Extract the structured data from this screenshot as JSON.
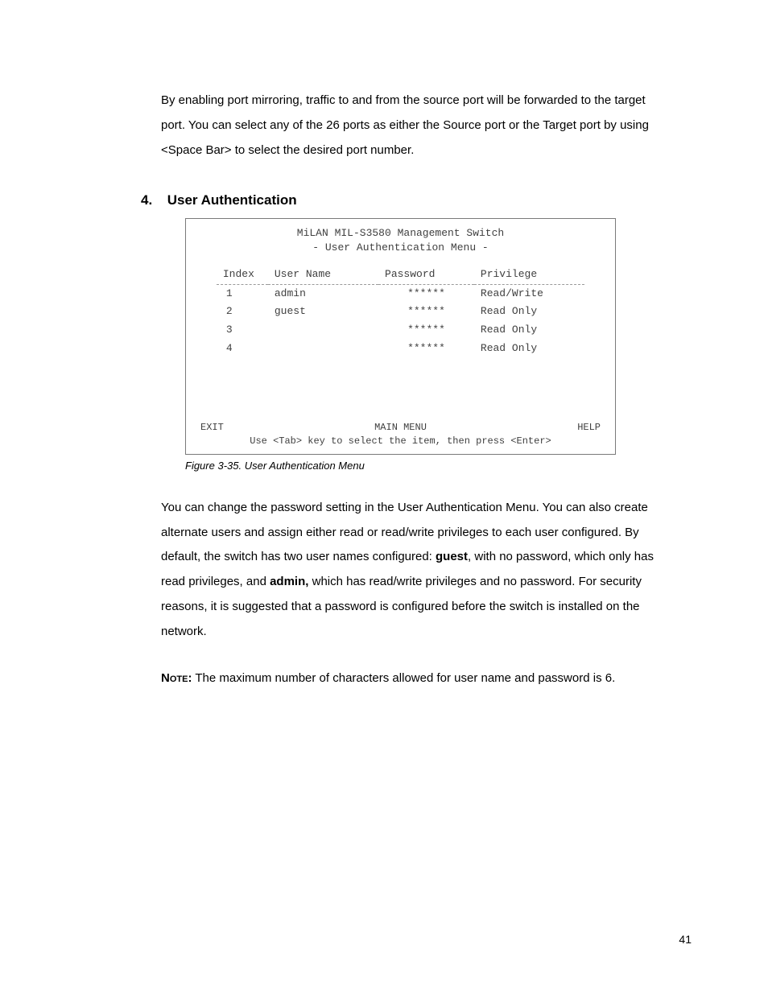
{
  "intro": "By enabling port mirroring, traffic to and from the source port will be forwarded to the target port. You can select any of the 26 ports as either the Source port or the Target port by using <Space Bar> to select the desired port number.",
  "section": {
    "number": "4.",
    "title": "User Authentication"
  },
  "figure": {
    "title": "MiLAN MIL-S3580 Management Switch",
    "subtitle": "- User Authentication Menu -",
    "headers": {
      "index": "Index",
      "user": "User Name",
      "password": "Password",
      "privilege": "Privilege"
    },
    "rows": [
      {
        "index": "1",
        "user": "admin",
        "password": "******",
        "privilege": "Read/Write"
      },
      {
        "index": "2",
        "user": "guest",
        "password": "******",
        "privilege": "Read Only"
      },
      {
        "index": "3",
        "user": "",
        "password": "******",
        "privilege": "Read Only"
      },
      {
        "index": "4",
        "user": "",
        "password": "******",
        "privilege": "Read Only"
      }
    ],
    "footer": {
      "left": "EXIT",
      "center_top": "MAIN MENU",
      "center_bottom": "Use <Tab> key to select the item, then press <Enter>",
      "right": "HELP"
    },
    "caption": "Figure 3-35. User Authentication Menu"
  },
  "body": {
    "p1_a": "You can change the password setting in the User Authentication Menu. You can also create alternate users and assign either read or read/write privileges to each user configured.   By default, the switch has two user names configured:  ",
    "guest": "guest",
    "p1_b": ", with no password, which only has read privileges, and ",
    "admin": "admin,",
    "p1_c": " which has read/write privileges and no password.  For security reasons, it is suggested that a password is configured before the switch is installed on the network.",
    "note_label": "Note:",
    "note_text": "  The maximum number of characters allowed for user name and password is 6."
  },
  "page_number": "41"
}
